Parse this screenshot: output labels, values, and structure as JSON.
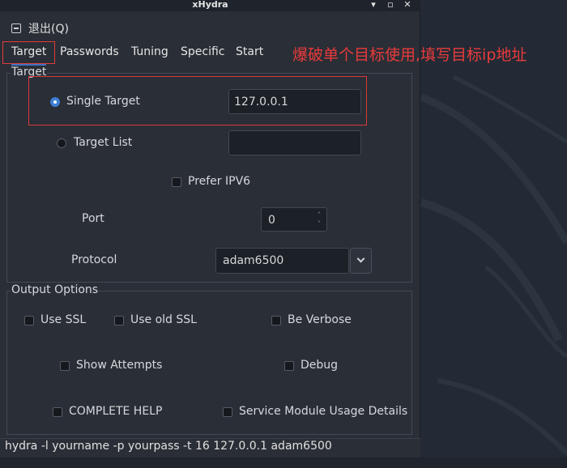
{
  "window": {
    "title": "xHydra"
  },
  "menu": {
    "quit_label": "退出(Q)"
  },
  "tabs": [
    {
      "label": "Target",
      "active": true
    },
    {
      "label": "Passwords"
    },
    {
      "label": "Tuning"
    },
    {
      "label": "Specific"
    },
    {
      "label": "Start"
    }
  ],
  "target": {
    "frame_label": "Target",
    "single_target_label": "Single Target",
    "single_target_value": "127.0.0.1",
    "single_target_selected": true,
    "target_list_label": "Target List",
    "target_list_value": "",
    "prefer_ipv6_label": "Prefer IPV6",
    "port_label": "Port",
    "port_value": "0",
    "protocol_label": "Protocol",
    "protocol_value": "adam6500"
  },
  "output": {
    "frame_label": "Output Options",
    "use_ssl": "Use SSL",
    "use_old_ssl": "Use old SSL",
    "be_verbose": "Be Verbose",
    "show_attempts": "Show Attempts",
    "debug": "Debug",
    "complete_help": "COMPLETE HELP",
    "service_module": "Service Module Usage Details"
  },
  "status": {
    "command": "hydra -l yourname -p yourpass -t 16 127.0.0.1 adam6500"
  },
  "annotation": {
    "text": "爆破单个目标使用,填写目标ip地址",
    "color": "#e83b3b"
  },
  "colors": {
    "accent": "#3f7fd6",
    "annotation_red": "#e23c3c",
    "desktop": "#232a35"
  }
}
